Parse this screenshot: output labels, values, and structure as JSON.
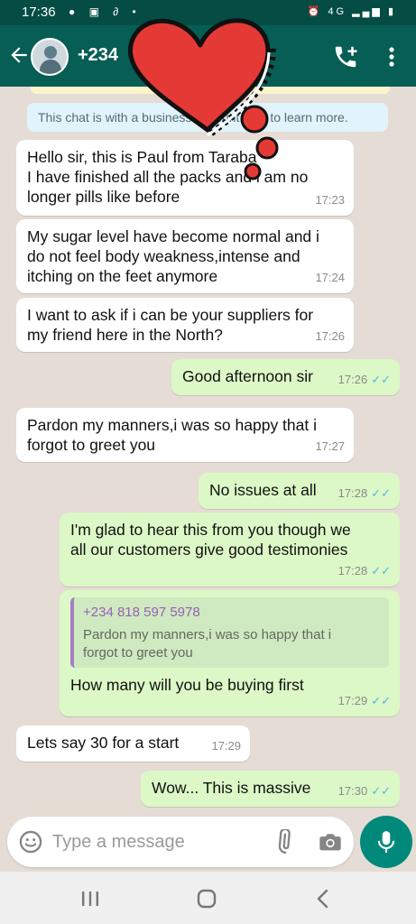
{
  "status_bar": {
    "time": "17:36",
    "network": "4G"
  },
  "header": {
    "contact_name": "+234"
  },
  "notice": {
    "text": "This chat is with a business account. Tap to learn more."
  },
  "messages": [
    {
      "text": [
        "Hello sir, this is Paul from Taraba",
        "I have finished all the packs and i am no",
        "longer pills like before"
      ],
      "time": "17:23"
    },
    {
      "text": [
        "My sugar level have become normal and i",
        "do not feel body weakness,intense and",
        "itching on the feet anymore"
      ],
      "time": "17:24"
    },
    {
      "text": [
        "I want to ask if i can be your suppliers for",
        "my friend here in the North?"
      ],
      "time": "17:26"
    },
    {
      "text": [
        "Good afternoon sir"
      ],
      "time": "17:26"
    },
    {
      "text": [
        "Pardon my manners,i was so happy that i",
        "forgot to greet you"
      ],
      "time": "17:27"
    },
    {
      "text": [
        "No issues at all"
      ],
      "time": "17:28"
    },
    {
      "text": [
        "I'm glad to hear this from you though we",
        "all our customers give good testimonies"
      ],
      "time": "17:28"
    },
    {
      "quote_name": "+234 818 597 5978",
      "quote_text": [
        "Pardon my manners,i was so happy that i",
        "forgot to greet you"
      ],
      "text": [
        "How many will you be buying first"
      ],
      "time": "17:29"
    },
    {
      "text": [
        "Lets say 30 for a start"
      ],
      "time": "17:29"
    },
    {
      "text": [
        "Wow... This is massive"
      ],
      "time": "17:30"
    }
  ],
  "ticks": "✓✓",
  "input": {
    "placeholder": "Type a message"
  },
  "colors": {
    "header": "#075e54",
    "status_bar": "#054d44",
    "incoming": "#ffffff",
    "outgoing": "#dcf8c6",
    "chat_bg": "#e5ddd5",
    "tick": "#4fb6ec",
    "mic": "#00897b",
    "heart": "#e53935"
  },
  "icons": [
    "back-arrow-icon",
    "add-call-icon",
    "more-vert-icon",
    "emoji-icon",
    "attach-icon",
    "camera-icon",
    "mic-icon",
    "recent-apps-icon",
    "home-icon",
    "nav-back-icon"
  ]
}
